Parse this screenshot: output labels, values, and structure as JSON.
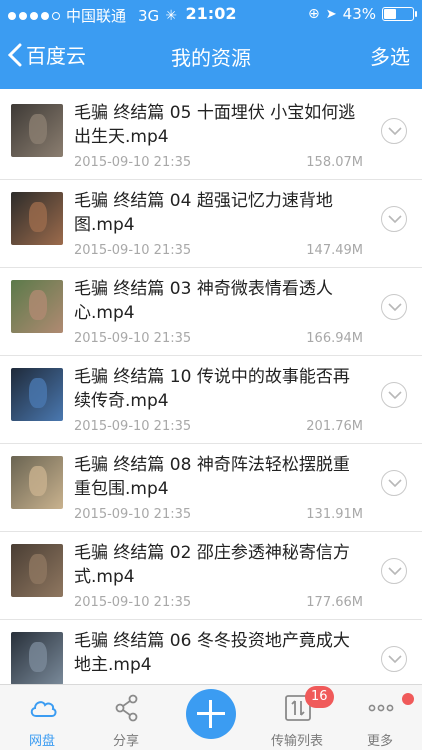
{
  "status_bar": {
    "carrier": "中国联通",
    "network": "3G",
    "time": "21:02",
    "battery": "43%",
    "battery_level": 0.43
  },
  "nav": {
    "back_label": "百度云",
    "title": "我的资源",
    "action_label": "多选"
  },
  "files": [
    {
      "name": "毛骗 终结篇 05 十面埋伏 小宝如何逃出生天.mp4",
      "date": "2015-09-10 21:35",
      "size": "158.07M"
    },
    {
      "name": "毛骗 终结篇 04 超强记忆力速背地图.mp4",
      "date": "2015-09-10 21:35",
      "size": "147.49M"
    },
    {
      "name": "毛骗 终结篇 03 神奇微表情看透人心.mp4",
      "date": "2015-09-10 21:35",
      "size": "166.94M"
    },
    {
      "name": "毛骗 终结篇 10 传说中的故事能否再续传奇.mp4",
      "date": "2015-09-10 21:35",
      "size": "201.76M"
    },
    {
      "name": "毛骗 终结篇 08 神奇阵法轻松摆脱重重包围.mp4",
      "date": "2015-09-10 21:35",
      "size": "131.91M"
    },
    {
      "name": "毛骗 终结篇 02 邵庄参透神秘寄信方式.mp4",
      "date": "2015-09-10 21:35",
      "size": "177.66M"
    },
    {
      "name": "毛骗 终结篇 06 冬冬投资地产竟成大地主.mp4",
      "date": "",
      "size": ""
    }
  ],
  "tabbar": {
    "netdisk": "网盘",
    "share": "分享",
    "transfer": "传输列表",
    "transfer_badge": "16",
    "more": "更多"
  },
  "colors": {
    "accent": "#3b9cf2",
    "badge": "#f05a5a"
  }
}
